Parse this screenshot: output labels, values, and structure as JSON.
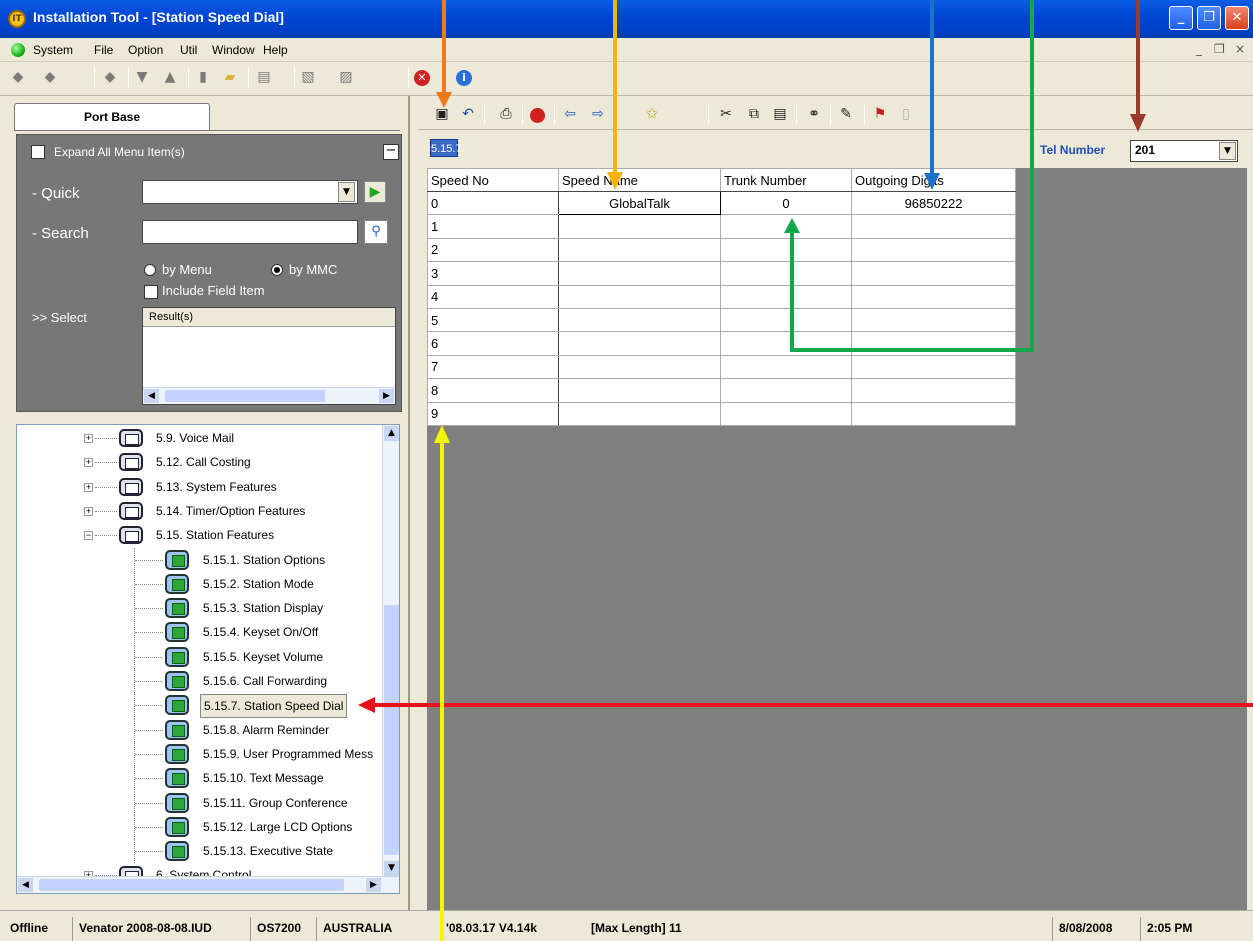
{
  "window": {
    "title": "Installation Tool - [Station Speed Dial]",
    "icon_letter": "IT"
  },
  "menu": {
    "items": [
      "System",
      "File",
      "Option",
      "Util",
      "Window",
      "Help"
    ],
    "mdi_controls": [
      "_",
      "❐",
      "×"
    ]
  },
  "left_panel": {
    "tab": "Port Base",
    "expand_label": "Expand All Menu Item(s)",
    "expand_toggle": "−",
    "quick_label": "- Quick",
    "search_label": "- Search",
    "radio_by_menu": "by Menu",
    "radio_by_mmc": "by MMC",
    "include_field": "Include Field Item",
    "select_label": ">> Select",
    "result_header": "Result(s)"
  },
  "tree": {
    "items": [
      {
        "label": "5.9. Voice Mail",
        "type": "folder",
        "expander": "+"
      },
      {
        "label": "5.12. Call Costing",
        "type": "folder",
        "expander": "+"
      },
      {
        "label": "5.13. System Features",
        "type": "folder",
        "expander": "+"
      },
      {
        "label": "5.14. Timer/Option Features",
        "type": "folder",
        "expander": "+"
      },
      {
        "label": "5.15. Station Features",
        "type": "folder",
        "expander": "−"
      },
      {
        "label": "5.15.1. Station Options",
        "type": "leaf"
      },
      {
        "label": "5.15.2. Station Mode",
        "type": "leaf"
      },
      {
        "label": "5.15.3. Station Display",
        "type": "leaf"
      },
      {
        "label": "5.15.4. Keyset On/Off",
        "type": "leaf"
      },
      {
        "label": "5.15.5. Keyset Volume",
        "type": "leaf"
      },
      {
        "label": "5.15.6. Call Forwarding",
        "type": "leaf"
      },
      {
        "label": "5.15.7. Station Speed Dial",
        "type": "leaf",
        "selected": true
      },
      {
        "label": "5.15.8. Alarm Reminder",
        "type": "leaf"
      },
      {
        "label": "5.15.9. User Programmed Mess",
        "type": "leaf"
      },
      {
        "label": "5.15.10. Text Message",
        "type": "leaf"
      },
      {
        "label": "5.15.11. Group Conference",
        "type": "leaf"
      },
      {
        "label": "5.15.12. Large LCD Options",
        "type": "leaf"
      },
      {
        "label": "5.15.13. Executive State",
        "type": "leaf"
      },
      {
        "label": "6. System Control",
        "type": "folder",
        "expander": "+"
      }
    ]
  },
  "right_panel": {
    "mmc_tag": "5.15.7.",
    "tel_number_label": "Tel Number",
    "tel_number_value": "201"
  },
  "grid": {
    "columns": [
      "Speed No",
      "Speed Name",
      "Trunk Number",
      "Outgoing Digits"
    ],
    "rows": [
      [
        "0",
        "GlobalTalk",
        "0",
        "96850222"
      ],
      [
        "1",
        "",
        "",
        ""
      ],
      [
        "2",
        "",
        "",
        ""
      ],
      [
        "3",
        "",
        "",
        ""
      ],
      [
        "4",
        "",
        "",
        ""
      ],
      [
        "5",
        "",
        "",
        ""
      ],
      [
        "6",
        "",
        "",
        ""
      ],
      [
        "7",
        "",
        "",
        ""
      ],
      [
        "8",
        "",
        "",
        ""
      ],
      [
        "9",
        "",
        "",
        ""
      ]
    ]
  },
  "statusbar": {
    "mode": "Offline",
    "file": "Venator 2008-08-08.IUD",
    "system": "OS7200",
    "country": "AUSTRALIA",
    "version": "'08.03.17 V4.14k",
    "max_length": "[Max Length] 11",
    "date": "8/08/2008",
    "time": "2:05 PM"
  },
  "annotation_colors": {
    "orange": "#f07a1a",
    "gold": "#f7b500",
    "blue": "#1a73c9",
    "green": "#12a84a",
    "brown": "#9a3b2a",
    "red": "#e8101a",
    "yellow": "#f5f500"
  }
}
